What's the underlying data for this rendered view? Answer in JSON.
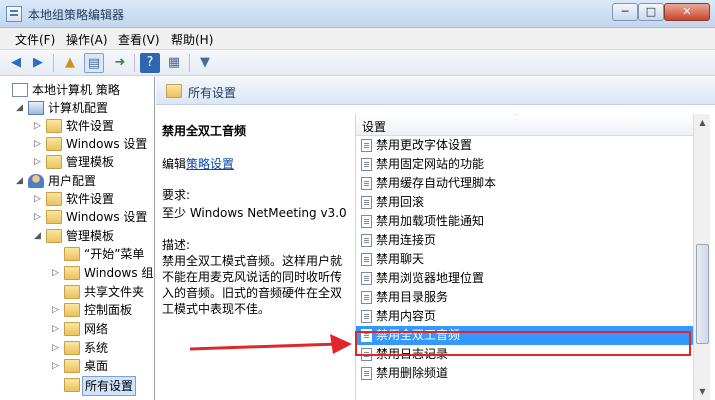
{
  "window": {
    "title": "本地组策略编辑器",
    "min_label": "─",
    "max_label": "□",
    "close_label": "✕"
  },
  "menu": [
    "文件(F)",
    "操作(A)",
    "查看(V)",
    "帮助(H)"
  ],
  "tree": {
    "items": [
      {
        "label": "本地计算机 策略",
        "icon": "policy-doc-icon"
      },
      {
        "label": "计算机配置",
        "icon": "computer-icon"
      },
      {
        "label": "软件设置",
        "icon": "folder-icon"
      },
      {
        "label": "Windows 设置",
        "icon": "folder-icon"
      },
      {
        "label": "管理模板",
        "icon": "folder-icon"
      },
      {
        "label": "用户配置",
        "icon": "user-icon"
      },
      {
        "label": "软件设置",
        "icon": "folder-icon"
      },
      {
        "label": "Windows 设置",
        "icon": "folder-icon"
      },
      {
        "label": "管理模板",
        "icon": "folder-icon"
      },
      {
        "label": "“开始”菜单",
        "icon": "folder-icon"
      },
      {
        "label": "Windows 组",
        "icon": "folder-icon"
      },
      {
        "label": "共享文件夹",
        "icon": "folder-icon"
      },
      {
        "label": "控制面板",
        "icon": "folder-icon"
      },
      {
        "label": "网络",
        "icon": "folder-icon"
      },
      {
        "label": "系统",
        "icon": "folder-icon"
      },
      {
        "label": "桌面",
        "icon": "folder-icon"
      },
      {
        "label": "所有设置",
        "icon": "settings-folder-icon"
      }
    ]
  },
  "panel": {
    "header": "所有设置",
    "desc": {
      "title": "禁用全双工音频",
      "edit_prefix": "编辑",
      "edit_link": "策略设置",
      "req_label": "要求:",
      "req_value": "至少 Windows NetMeeting v3.0",
      "desc_label": "描述:",
      "desc_text": "禁用全双工模式音频。这样用户就不能在用麦克风说话的同时收听传入的音频。旧式的音频硬件在全双工模式中表现不佳。"
    },
    "column_header": "设置",
    "settings": [
      "禁用更改字体设置",
      "禁用固定网站的功能",
      "禁用缓存自动代理脚本",
      "禁用回滚",
      "禁用加载项性能通知",
      "禁用连接页",
      "禁用聊天",
      "禁用浏览器地理位置",
      "禁用目录服务",
      "禁用内容页",
      "禁用全双工音频",
      "禁用日志记录",
      "禁用删除频道"
    ],
    "selected_setting": "禁用全双工音频"
  },
  "colors": {
    "selection": "#3399ff",
    "annotation": "#e0262b"
  }
}
